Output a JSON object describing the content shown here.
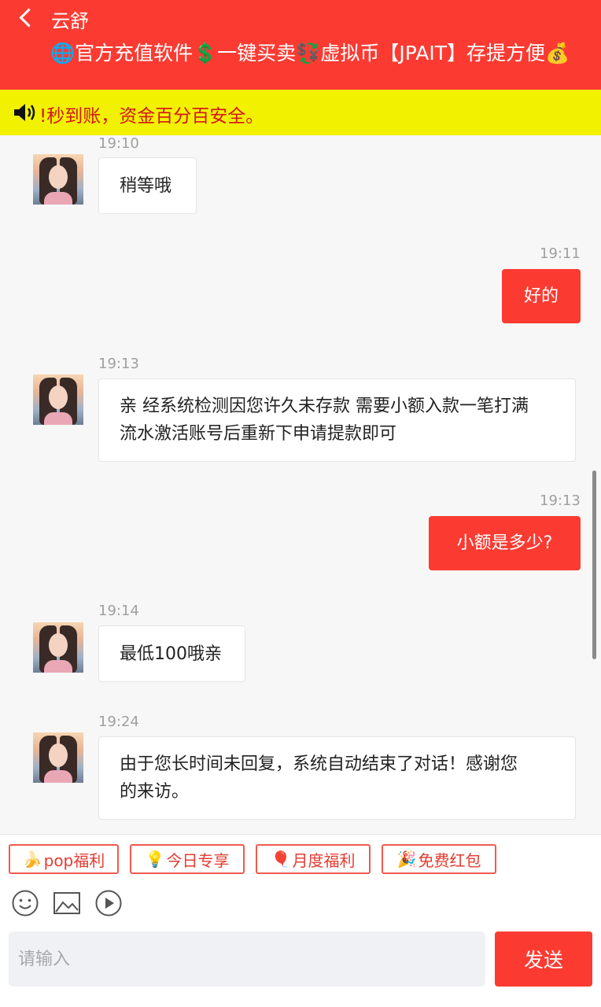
{
  "header": {
    "name": "云舒",
    "subtitle": "🌐官方充值软件💲一键买卖💱虚拟币【JPAIT】存提方便💰"
  },
  "notice": {
    "text": "!秒到账，资金百分百安全。"
  },
  "messages": [
    {
      "side": "in",
      "time": "19:10",
      "text": "稍等哦"
    },
    {
      "side": "out",
      "time": "19:11",
      "text": "好的"
    },
    {
      "side": "in",
      "time": "19:13",
      "lines": [
        "亲 经系统检测因您许久未存款 需要小额入款一笔打满",
        "流水激活账号后重新下申请提款即可"
      ]
    },
    {
      "side": "out",
      "time": "19:13",
      "text": "小额是多少?"
    },
    {
      "side": "in",
      "time": "19:14",
      "text": "最低100哦亲"
    },
    {
      "side": "in",
      "time": "19:24",
      "lines": [
        "由于您长时间未回复，系统自动结束了对话！感谢您",
        "的来访。"
      ]
    }
  ],
  "quick_replies": [
    {
      "emoji": "🍌",
      "label": "pop福利"
    },
    {
      "emoji": "💡",
      "label": "今日专享"
    },
    {
      "emoji": "🎈",
      "label": "月度福利"
    },
    {
      "emoji": "🎉",
      "label": "免费红包"
    }
  ],
  "tools": [
    "emoji-icon",
    "image-icon",
    "video-icon"
  ],
  "composer": {
    "placeholder": "请输入",
    "value": "",
    "send_label": "发送"
  },
  "colors": {
    "header_bg": "#fb3b32",
    "notice_bg": "#f2f200",
    "notice_text": "#d4151d",
    "outgoing_bubble": "#fb3b32",
    "incoming_bubble": "#ffffff",
    "chip_border": "#f05a4f"
  }
}
